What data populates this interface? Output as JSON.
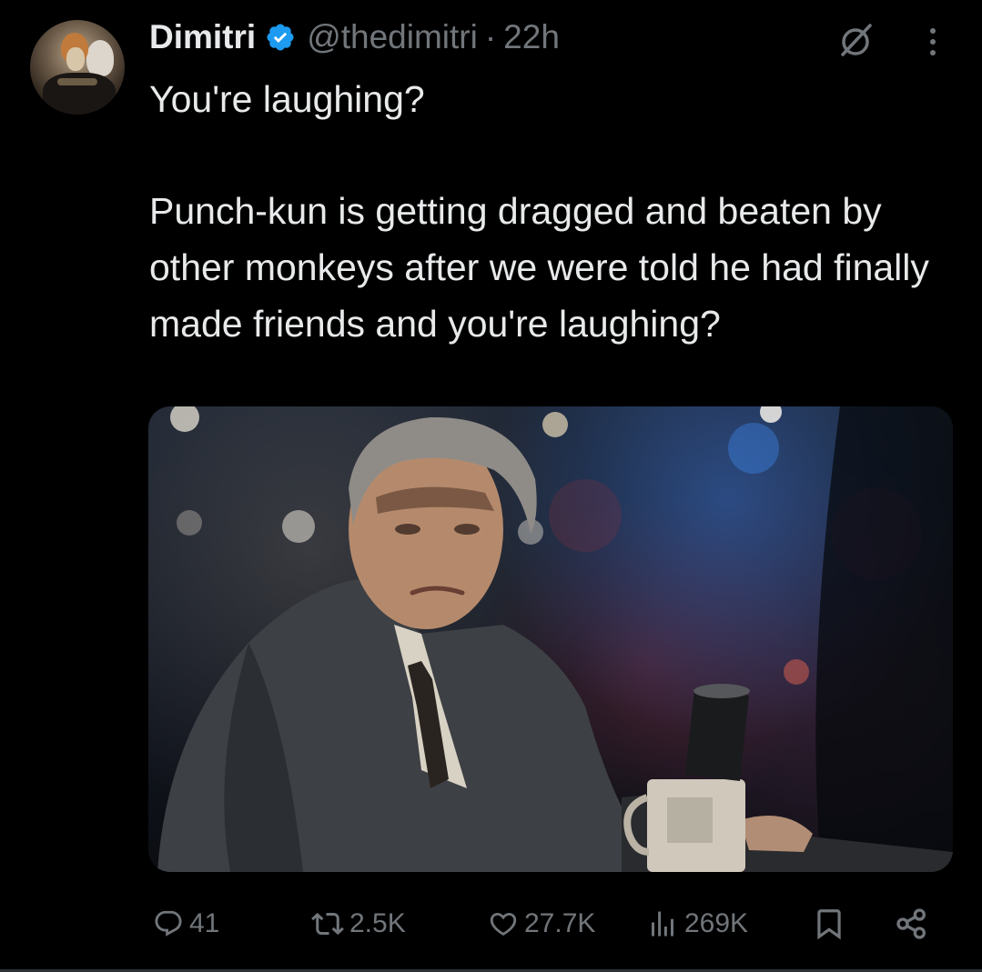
{
  "author": {
    "display_name": "Dimitri",
    "handle": "@thedimitri",
    "separator": "·",
    "timestamp": "22h",
    "verified": true,
    "verified_color": "#1d9bf0"
  },
  "tweet": {
    "line1": "You're laughing?",
    "line2": "Punch-kun is getting dragged and beaten by other monkeys after we were told he had finally made friends and you're laughing?"
  },
  "media": {
    "type": "image",
    "description_icon": "photo"
  },
  "actions": {
    "replies": "41",
    "reposts": "2.5K",
    "likes": "27.7K",
    "views": "269K"
  },
  "icons": {
    "reply": "reply-icon",
    "repost": "repost-icon",
    "like": "heart-icon",
    "views": "views-icon",
    "bookmark": "bookmark-icon",
    "share": "share-icon",
    "grok": "grok-icon",
    "more": "more-icon"
  },
  "colors": {
    "background": "#000000",
    "text": "#e7e9ea",
    "secondary": "#71767b",
    "accent": "#1d9bf0"
  }
}
